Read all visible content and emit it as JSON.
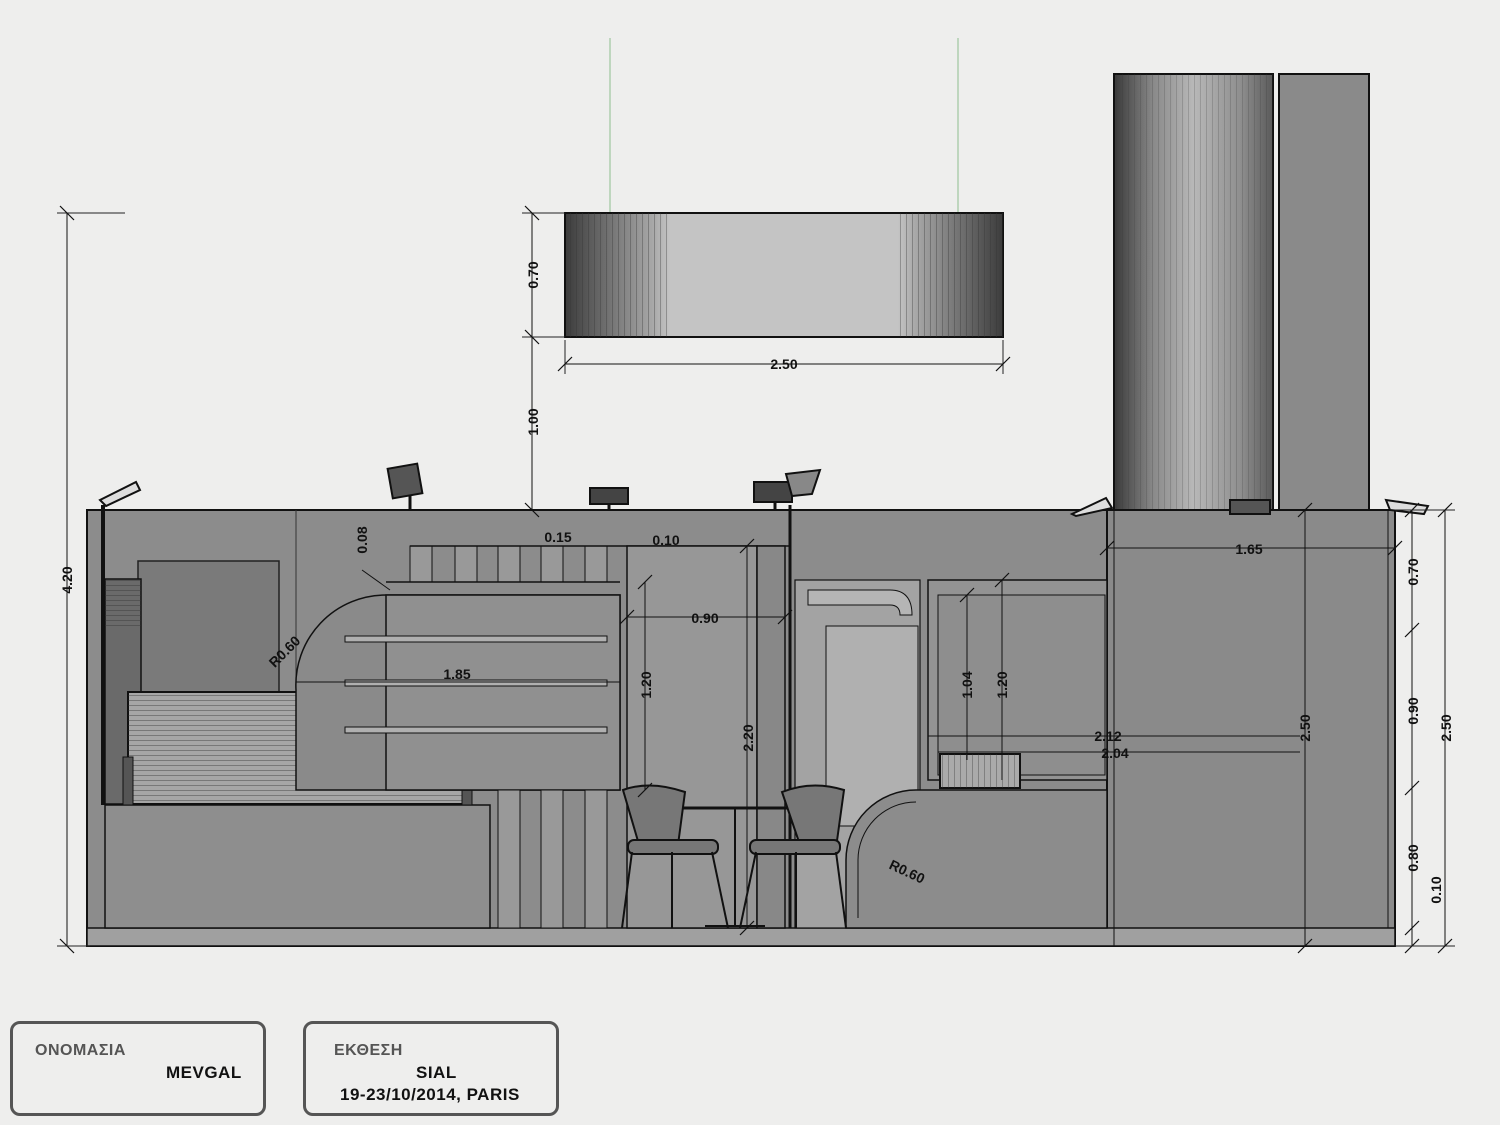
{
  "dimensions": {
    "banner_height": "0.70",
    "banner_width": "2.50",
    "banner_clearance": "1.00",
    "total_height": "4.20",
    "d_015": "0.15",
    "d_010": "0.10",
    "d_008": "0.08",
    "d_r060_left": "R0.60",
    "d_185": "1.85",
    "d_090_h": "0.90",
    "d_120_left": "1.20",
    "d_220": "2.20",
    "d_104": "1.04",
    "d_120_right": "1.20",
    "d_212": "2.12",
    "d_204": "2.04",
    "d_r060_right": "R0.60",
    "d_165": "1.65",
    "d_250_inner": "2.50",
    "d_070_right": "0.70",
    "d_090_right": "0.90",
    "d_080_right": "0.80",
    "d_010_right": "0.10",
    "d_250_right": "2.50"
  },
  "info": {
    "name_label": "ΟΝΟΜΑΣΙΑ",
    "name_value": "MEVGAL",
    "expo_label": "ΕΚΘΕΣΗ",
    "expo_value": "SIAL",
    "expo_dates": "19-23/10/2014, PARIS"
  }
}
